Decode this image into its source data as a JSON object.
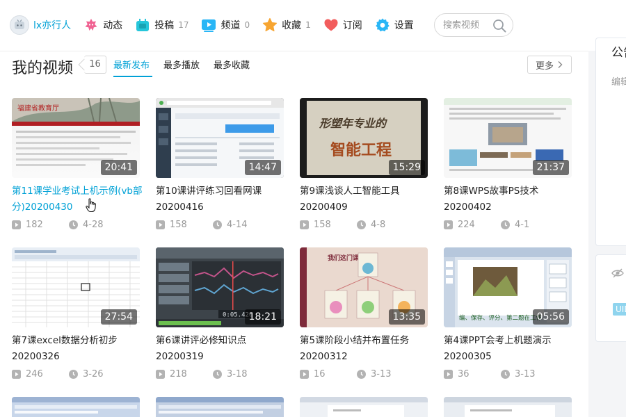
{
  "nav": {
    "user_name": "lx亦行人",
    "items": [
      {
        "label": "动态",
        "count": ""
      },
      {
        "label": "投稿",
        "count": "17"
      },
      {
        "label": "频道",
        "count": "0"
      },
      {
        "label": "收藏",
        "count": "1"
      },
      {
        "label": "订阅",
        "count": ""
      },
      {
        "label": "设置",
        "count": ""
      }
    ],
    "search_placeholder": "搜索视频"
  },
  "section": {
    "title": "我的视频",
    "count": "16",
    "tabs": [
      "最新发布",
      "最多播放",
      "最多收藏"
    ],
    "active_tab": "最新发布",
    "more_label": "更多"
  },
  "videos": [
    {
      "title": "第11课学业考试上机示例(vb部分)20200430",
      "duration": "20:41",
      "plays": "182",
      "date": "4-28",
      "thumb": "web-red"
    },
    {
      "title": "第10课讲评练习回看网课20200416",
      "duration": "14:47",
      "plays": "158",
      "date": "4-14",
      "thumb": "dashboard"
    },
    {
      "title": "第9课浅谈人工智能工具20200409",
      "duration": "15:29",
      "plays": "158",
      "date": "4-8",
      "thumb": "calligraphy"
    },
    {
      "title": "第8课WPS故事PS技术20200402",
      "duration": "21:37",
      "plays": "224",
      "date": "4-1",
      "thumb": "doc-photo"
    },
    {
      "title": "第7课excel数据分析初步20200326",
      "duration": "27:54",
      "plays": "246",
      "date": "3-26",
      "thumb": "excel"
    },
    {
      "title": "第6课讲评必修知识点20200319",
      "duration": "18:21",
      "plays": "218",
      "date": "3-18",
      "thumb": "audio"
    },
    {
      "title": "第5课阶段小结并布置任务20200312",
      "duration": "13:35",
      "plays": "16",
      "date": "3-13",
      "thumb": "mindmap"
    },
    {
      "title": "第4课PPT会考上机题演示20200305",
      "duration": "05:56",
      "plays": "36",
      "date": "3-13",
      "thumb": "ppt"
    }
  ],
  "thumb_text": {
    "calligraphy_line1": "形塑年专业的",
    "calligraphy_line2": "智能工程",
    "web_header": "福建省教育厅",
    "mindmap_title": "我们这门课",
    "ppt_caption": "编、保存、评分、第二题在工作",
    "audio_time": "0:05.420"
  },
  "sidebar": {
    "title": "公告",
    "edit": "编辑",
    "uid": "UID"
  },
  "colors": {
    "accent": "#00a1d6",
    "text": "#222222",
    "muted": "#999999"
  }
}
